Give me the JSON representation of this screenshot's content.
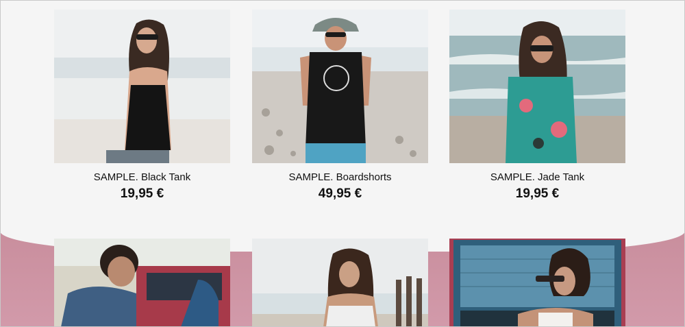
{
  "products": [
    {
      "name": "SAMPLE. Black Tank",
      "price": "19,95 €",
      "image": "woman-black-tank-beach"
    },
    {
      "name": "SAMPLE. Boardshorts",
      "price": "49,95 €",
      "image": "man-hat-boardshorts-beach"
    },
    {
      "name": "SAMPLE. Jade Tank",
      "price": "19,95 €",
      "image": "woman-floral-tank-beach"
    },
    {
      "image": "man-plaid-shirt-red-van"
    },
    {
      "image": "woman-white-top-beach"
    },
    {
      "image": "woman-sunglasses-blue-van"
    }
  ],
  "colors": {
    "background": "#f5f5f5",
    "accent_band": "#cf97a6",
    "text": "#111111"
  }
}
